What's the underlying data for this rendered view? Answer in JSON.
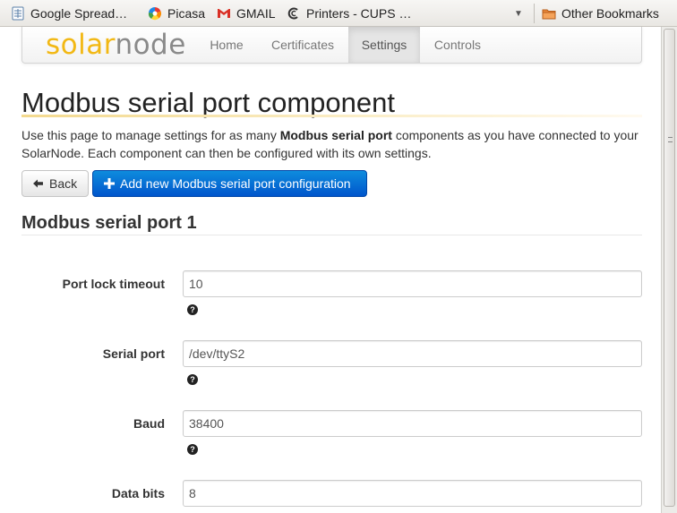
{
  "bookmarks": {
    "items": [
      {
        "label": "Google Spread…",
        "icon": "spreadsheet-icon"
      },
      {
        "label": "Picasa",
        "icon": "picasa-icon"
      },
      {
        "label": "GMAIL",
        "icon": "gmail-icon"
      },
      {
        "label": "Printers - CUPS …",
        "icon": "cups-icon"
      }
    ],
    "other_label": "Other Bookmarks"
  },
  "navbar": {
    "brand_solar": "solar",
    "brand_node": "node",
    "items": [
      {
        "label": "Home"
      },
      {
        "label": "Certificates"
      },
      {
        "label": "Settings",
        "active": true
      },
      {
        "label": "Controls"
      }
    ]
  },
  "page": {
    "title": "Modbus serial port component",
    "intro_part1": "Use this page to manage settings for as many ",
    "intro_bold": "Modbus serial port",
    "intro_part2": " components as you have connected to your SolarNode. Each component can then be configured with its own settings.",
    "back_label": "Back",
    "add_label": "Add new Modbus serial port configuration",
    "section_title": "Modbus serial port 1"
  },
  "form": {
    "fields": [
      {
        "label": "Port lock timeout",
        "value": "10"
      },
      {
        "label": "Serial port",
        "value": "/dev/ttyS2"
      },
      {
        "label": "Baud",
        "value": "38400"
      },
      {
        "label": "Data bits",
        "value": "8"
      }
    ],
    "help_glyph": "?"
  },
  "colors": {
    "brand_yellow": "#f2b814",
    "brand_gray": "#8a8a8a",
    "primary_blue": "#0066cc"
  }
}
